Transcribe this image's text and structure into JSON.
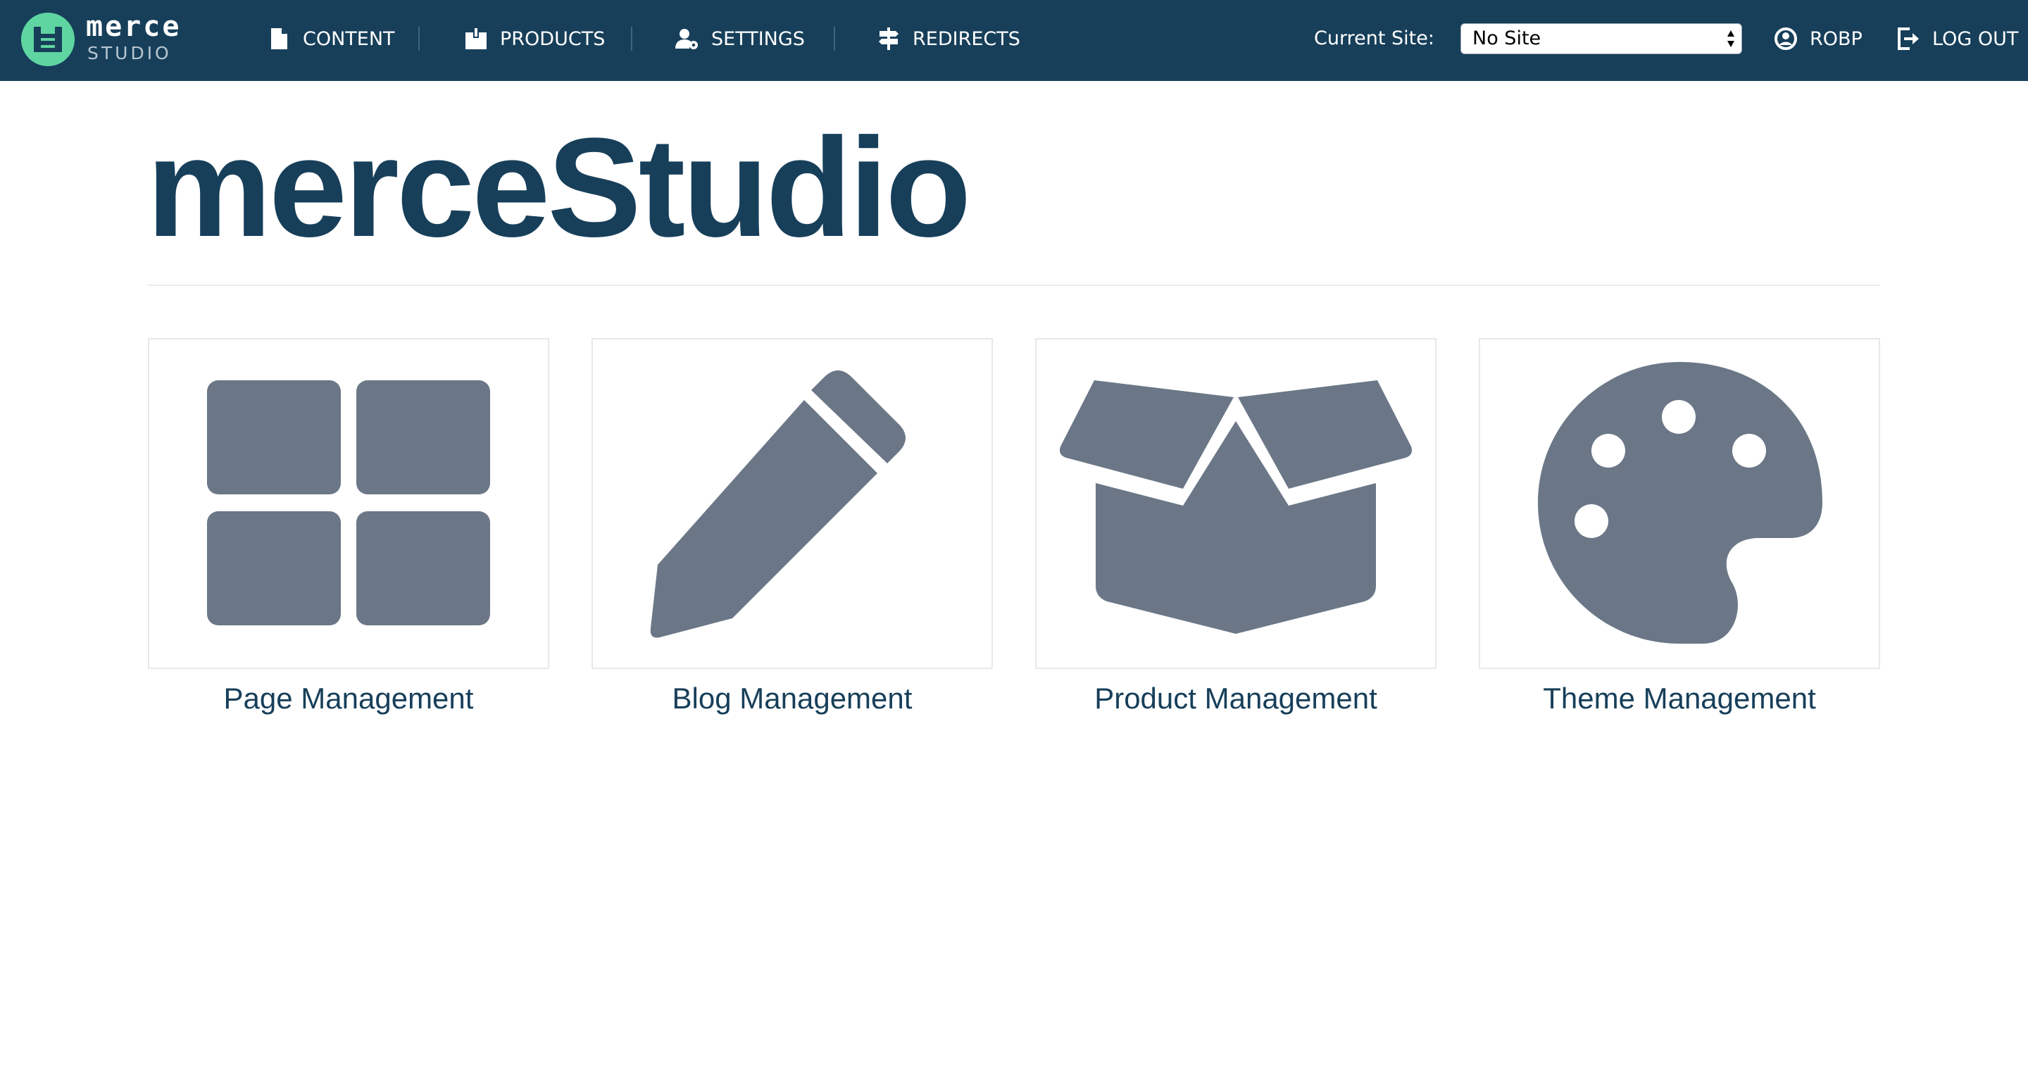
{
  "brand": {
    "wordmark": "merce",
    "subtitle": "STUDIO",
    "accent_color": "#5fd5a1",
    "bar_color": "#173f5a"
  },
  "nav": {
    "items": [
      {
        "label": "CONTENT",
        "icon": "file-icon"
      },
      {
        "label": "PRODUCTS",
        "icon": "box-icon"
      },
      {
        "label": "SETTINGS",
        "icon": "user-cog-icon"
      },
      {
        "label": "REDIRECTS",
        "icon": "signpost-icon"
      }
    ],
    "site_label": "Current Site:",
    "site_value": "No Site",
    "user_label": "ROBP",
    "logout_label": "LOG OUT"
  },
  "page": {
    "title": "merceStudio"
  },
  "cards": [
    {
      "label": "Page Management",
      "icon": "grid-icon"
    },
    {
      "label": "Blog Management",
      "icon": "pencil-icon"
    },
    {
      "label": "Product Management",
      "icon": "open-box-icon"
    },
    {
      "label": "Theme Management",
      "icon": "palette-icon"
    }
  ],
  "icon_color": "#6b7787"
}
